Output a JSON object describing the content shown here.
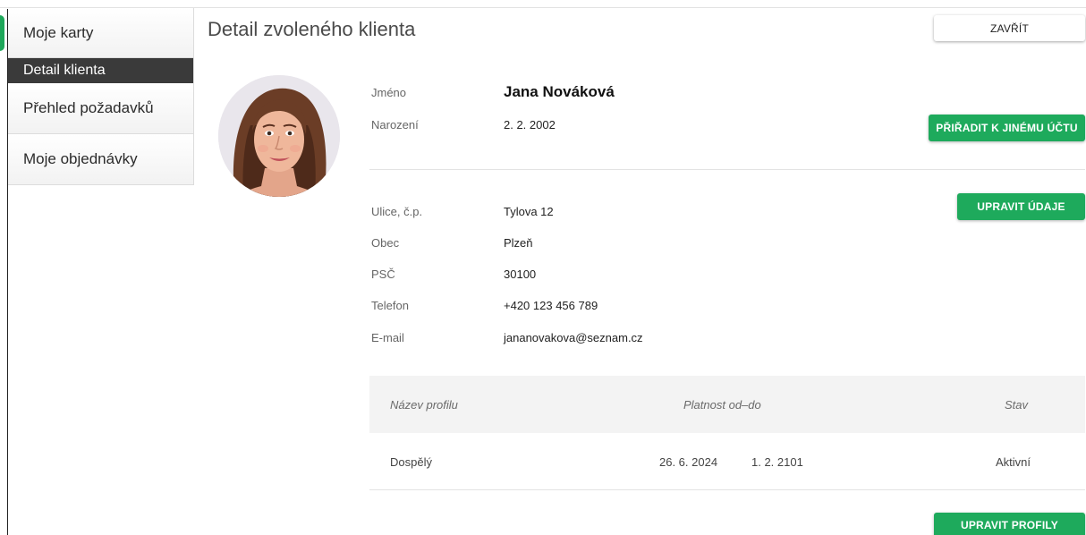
{
  "sidebar": {
    "items": [
      {
        "label": "Moje karty"
      },
      {
        "label": "Detail klienta"
      },
      {
        "label": "Přehled požadavků"
      },
      {
        "label": "Moje objednávky"
      }
    ]
  },
  "header": {
    "title": "Detail zvoleného klienta",
    "close_label": "ZAVŘÍT"
  },
  "client": {
    "name_label": "Jméno",
    "name": "Jana Nováková",
    "birth_label": "Narození",
    "birth": "2. 2. 2002",
    "street_label": "Ulice, č.p.",
    "street": "Tylova 12",
    "city_label": "Obec",
    "city": "Plzeň",
    "zip_label": "PSČ",
    "zip": "30100",
    "phone_label": "Telefon",
    "phone": "+420 123 456 789",
    "email_label": "E-mail",
    "email": "jananovakova@seznam.cz"
  },
  "actions": {
    "assign_label": "PŘIŘADIT K JINÉMU ÚČTU",
    "edit_label": "UPRAVIT ÚDAJE",
    "profiles_label": "UPRAVIT PROFILY"
  },
  "profiles_table": {
    "columns": [
      "Název profilu",
      "Platnost od–do",
      "Stav"
    ],
    "rows": [
      {
        "name": "Dospělý",
        "from": "26. 6. 2024",
        "to": "1. 2. 2101",
        "status": "Aktivní"
      }
    ]
  },
  "colors": {
    "accent": "#1eaa5c",
    "active_nav": "#3a3a3a"
  }
}
